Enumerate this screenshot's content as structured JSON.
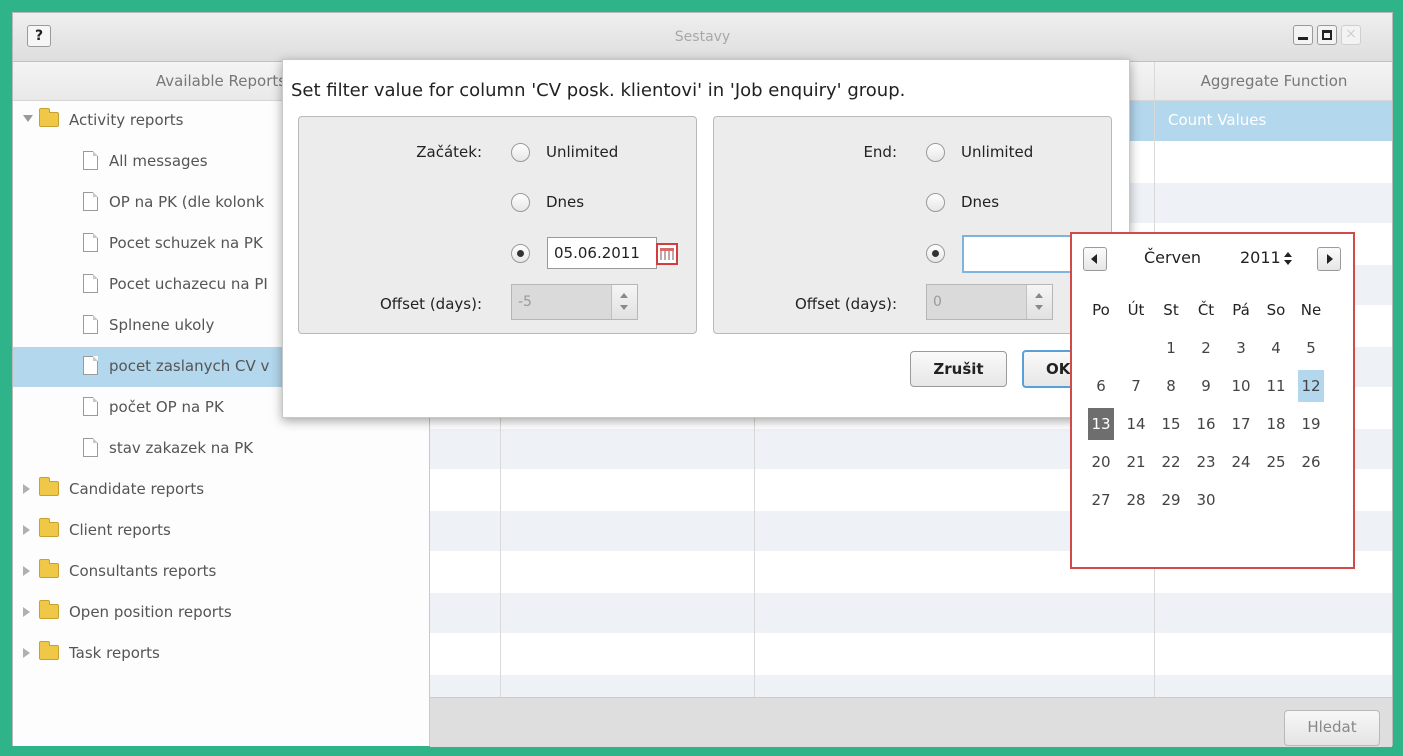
{
  "window": {
    "title": "Sestavy",
    "help_label": "?",
    "close_label": "×"
  },
  "reports_panel": {
    "header": "Available Reports",
    "categories": [
      {
        "label": "Activity reports",
        "expanded": true
      },
      {
        "label": "Candidate reports",
        "expanded": false
      },
      {
        "label": "Client reports",
        "expanded": false
      },
      {
        "label": "Consultants reports",
        "expanded": false
      },
      {
        "label": "Open position reports",
        "expanded": false
      },
      {
        "label": "Task reports",
        "expanded": false
      }
    ],
    "activity_reports": [
      "All messages",
      "OP na PK (dle kolonk",
      "Pocet schuzek na PK",
      "Pocet uchazecu na PI",
      "Splnene ukoly",
      "pocet zaslanych CV v",
      "počet OP na PK",
      "stav zakazek na PK"
    ],
    "selected_report": "pocet zaslanych CV v"
  },
  "grid": {
    "aggregate_header": "Aggregate Function",
    "aggregate_value": "Count Values",
    "selected_row_color": "#b3d7ec"
  },
  "search_button": "Hledat",
  "dialog": {
    "title": "Set filter value for column 'CV posk. klientovi' in 'Job enquiry' group.",
    "start": {
      "label": "Začátek:",
      "options": [
        "Unlimited",
        "Dnes"
      ],
      "selected_option": "date",
      "date_value": "05.06.2011",
      "offset_label": "Offset (days):",
      "offset_value": "-5"
    },
    "end": {
      "label": "End:",
      "options": [
        "Unlimited",
        "Dnes"
      ],
      "selected_option": "date",
      "date_value": "",
      "offset_label": "Offset (days):",
      "offset_value": "0"
    },
    "cancel_button": "Zrušit",
    "ok_button": "OK"
  },
  "calendar": {
    "month": "Červen",
    "year": "2011",
    "weekdays": [
      "Po",
      "Út",
      "St",
      "Čt",
      "Pá",
      "So",
      "Ne"
    ],
    "weeks": [
      [
        "",
        "",
        "1",
        "2",
        "3",
        "4",
        "5"
      ],
      [
        "6",
        "7",
        "8",
        "9",
        "10",
        "11",
        "12"
      ],
      [
        "13",
        "14",
        "15",
        "16",
        "17",
        "18",
        "19"
      ],
      [
        "20",
        "21",
        "22",
        "23",
        "24",
        "25",
        "26"
      ],
      [
        "27",
        "28",
        "29",
        "30",
        "",
        "",
        ""
      ]
    ],
    "today": "12",
    "selected": "13",
    "border_color": "#d04a4a"
  }
}
